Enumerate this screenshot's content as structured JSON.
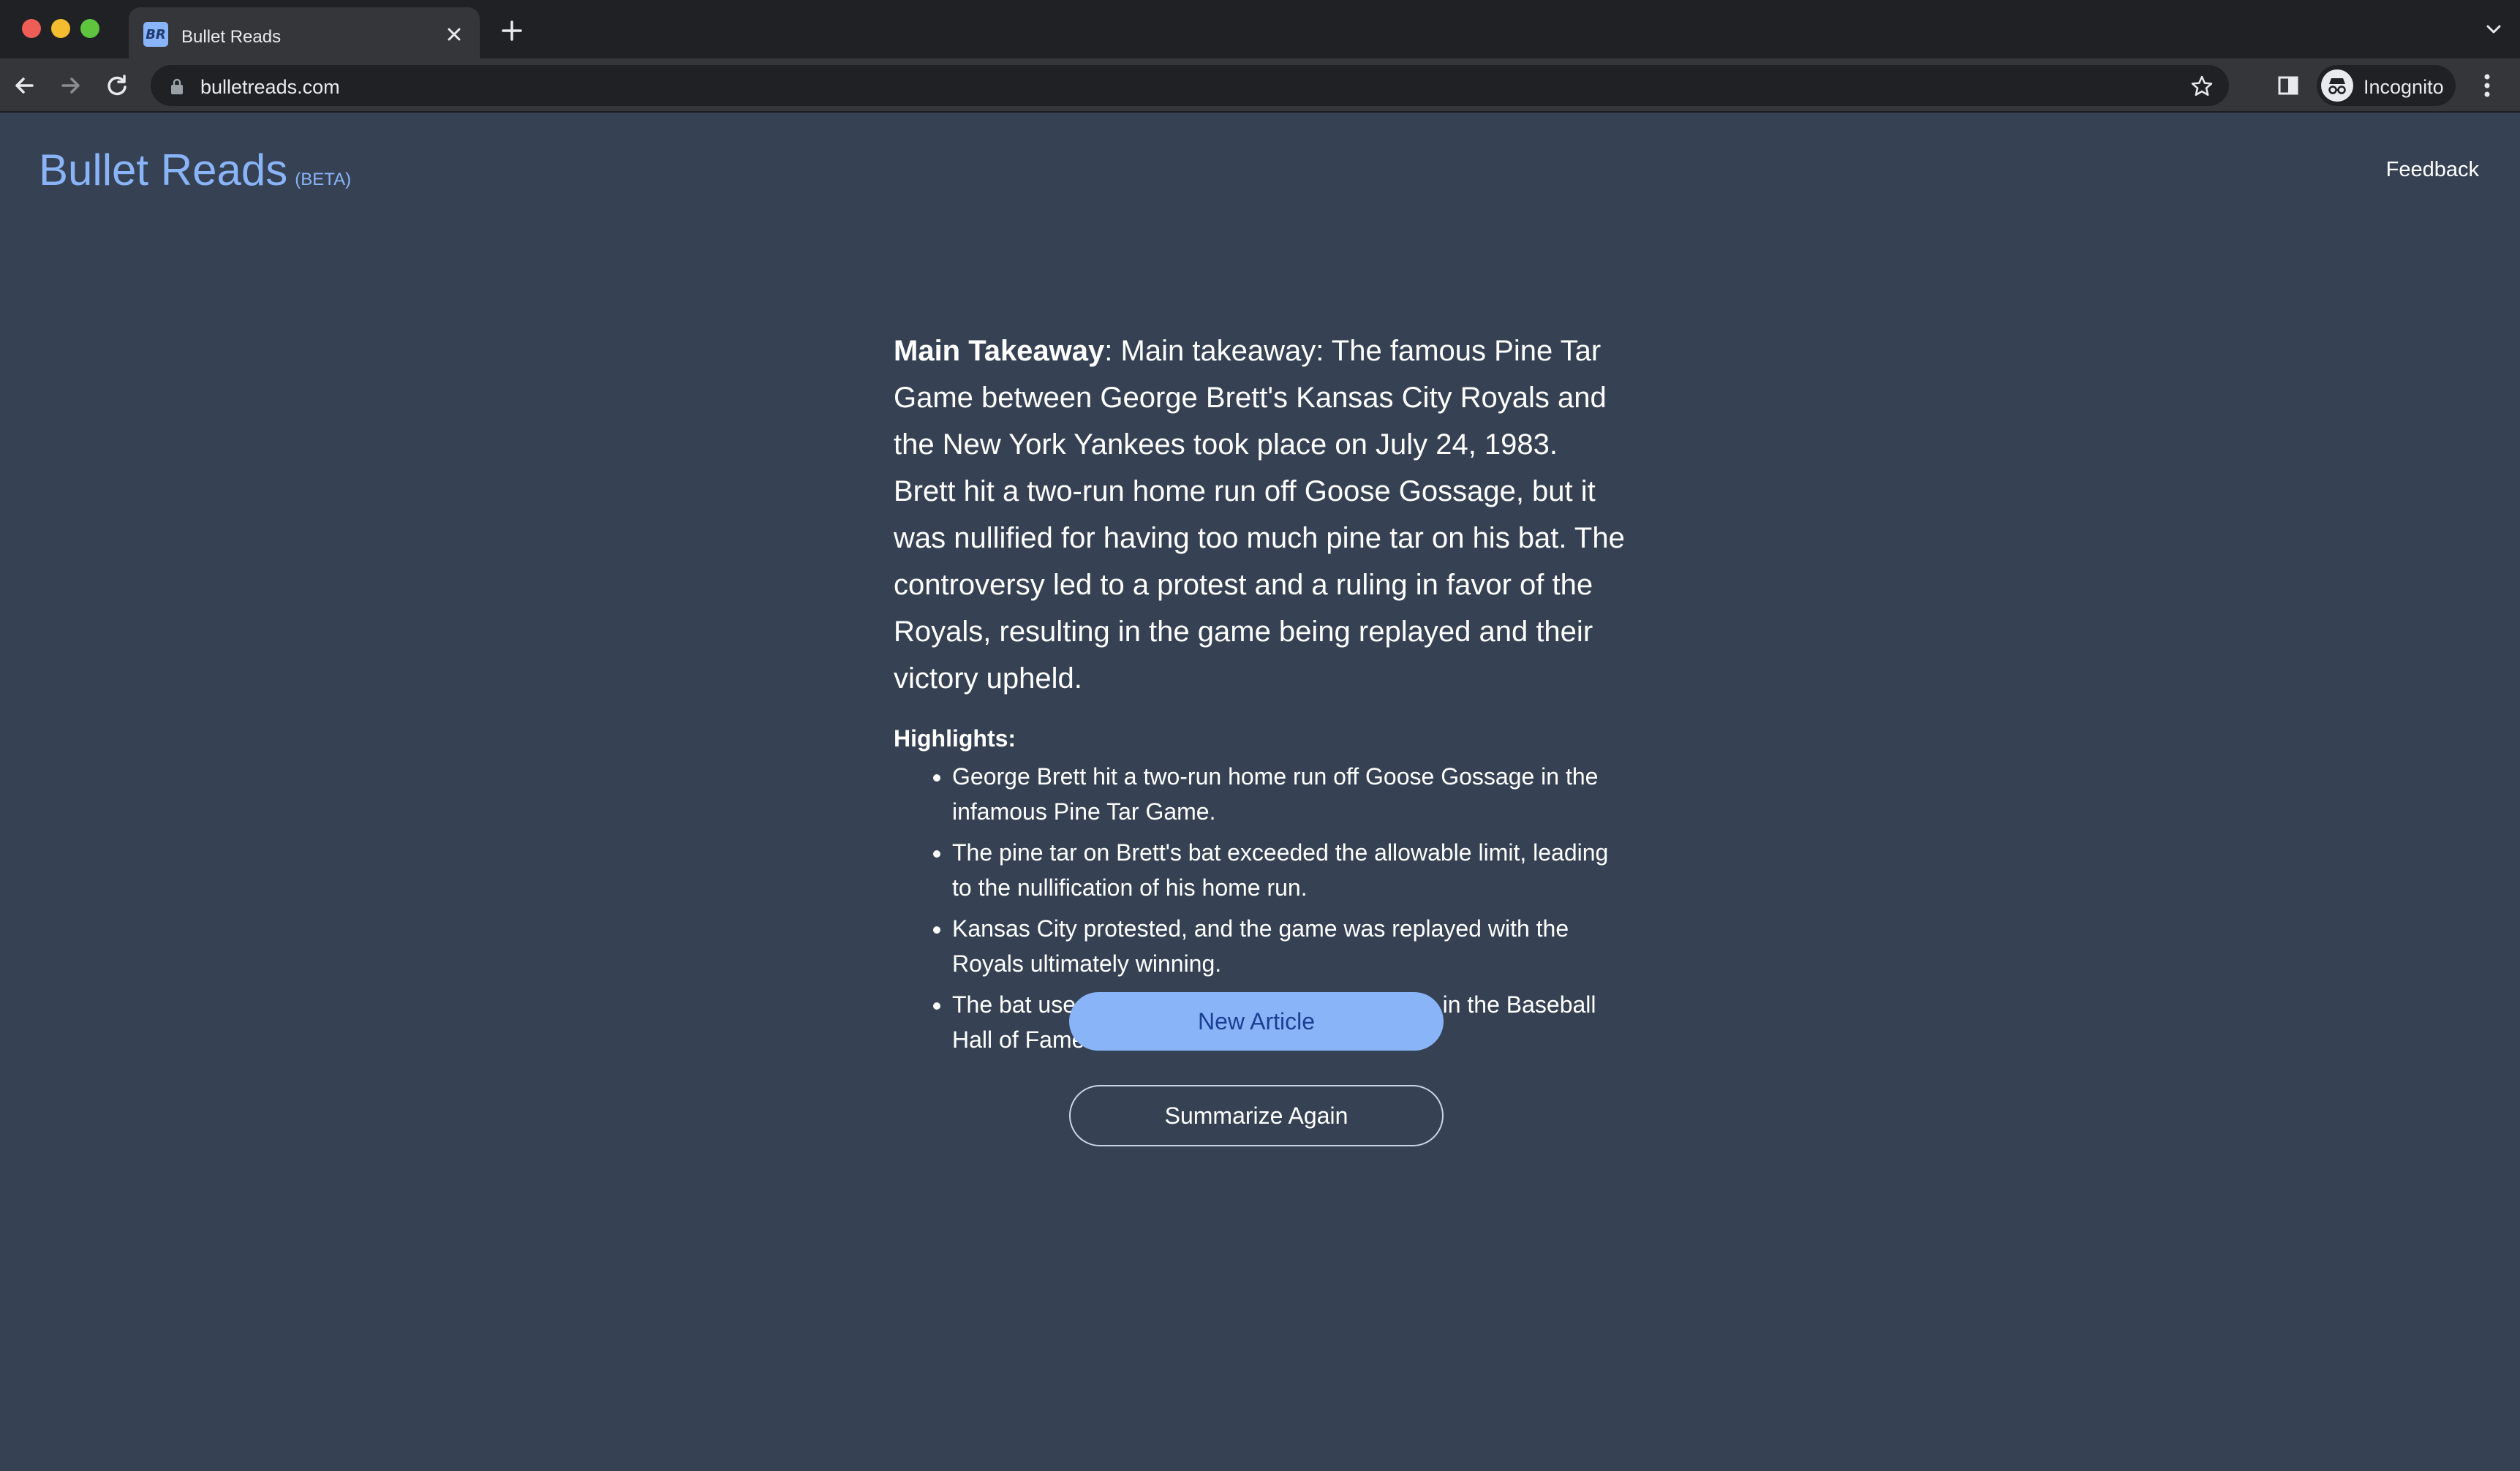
{
  "browser": {
    "tab_title": "Bullet Reads",
    "favicon_text": "BR",
    "url": "bulletreads.com",
    "profile_label": "Incognito",
    "icons": {
      "back": "arrow-left-icon",
      "forward": "arrow-right-icon",
      "reload": "reload-icon",
      "lock": "lock-icon",
      "bookmark": "star-icon",
      "side_panel": "side-panel-icon",
      "menu": "more-vert-icon",
      "new_tab": "plus-icon",
      "close_tab": "close-icon",
      "tab_search": "chevron-down-icon"
    }
  },
  "header": {
    "brand": "Bullet Reads",
    "beta": "(BETA)",
    "feedback": "Feedback"
  },
  "summary": {
    "takeaway_label": "Main Takeaway",
    "takeaway_text": ": Main takeaway: The famous Pine Tar Game between George Brett's Kansas City Royals and the New York Yankees took place on July 24, 1983. Brett hit a two-run home run off Goose Gossage, but it was nullified for having too much pine tar on his bat. The controversy led to a protest and a ruling in favor of the Royals, resulting in the game being replayed and their victory upheld.",
    "highlights_title": "Highlights:",
    "highlights": [
      "George Brett hit a two-run home run off Goose Gossage in the infamous Pine Tar Game.",
      "The pine tar on Brett's bat exceeded the allowable limit, leading to the nullification of his home run.",
      "Kansas City protested, and the game was replayed with the Royals ultimately winning.",
      "The bat used by Brett in the game now resides in the Baseball Hall of Fame."
    ]
  },
  "actions": {
    "new_article": "New Article",
    "summarize_again": "Summarize Again"
  },
  "colors": {
    "page_bg": "#364254",
    "accent": "#8ab4f8",
    "button_text": "#1a3f94"
  }
}
